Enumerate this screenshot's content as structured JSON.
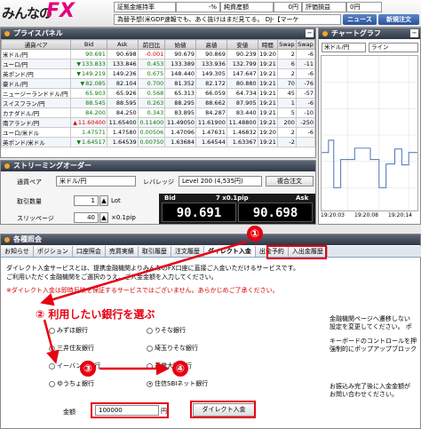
{
  "header": {
    "logo_text": "みんなの",
    "logo_fx": "FX",
    "info": [
      {
        "label": "証拠金維持率",
        "value": "-%"
      },
      {
        "label": "純資産額",
        "value": "0円"
      },
      {
        "label": "評価損益",
        "value": "0円"
      }
    ],
    "ticker": "為替予想(米GDP速報でも、あく抜けはまだ見てる。 DJ-【マーケ",
    "news_btn": "ニュース",
    "new_order_btn": "新規注文"
  },
  "price_panel": {
    "title": "プライスパネル",
    "columns": [
      "通貨ペア",
      "Bid",
      "Ask",
      "前日比",
      "始値",
      "高値",
      "安値",
      "時間",
      "Swap",
      "Swap"
    ],
    "rows": [
      {
        "pair": "米ドル/円",
        "bid": "90.691",
        "ask": "90.698",
        "chg": "-0.001",
        "open": "90.679",
        "high": "90.869",
        "low": "90.239",
        "time": "19:20",
        "s1": "2",
        "s2": "-6",
        "dir": "none"
      },
      {
        "pair": "ユーロ/円",
        "bid": "133.833",
        "ask": "133.846",
        "chg": "0.453",
        "open": "133.389",
        "high": "133.936",
        "low": "132.799",
        "time": "19:21",
        "s1": "6",
        "s2": "-11",
        "dir": "up"
      },
      {
        "pair": "英ポンド/円",
        "bid": "149.219",
        "ask": "149.236",
        "chg": "0.675",
        "open": "148.440",
        "high": "149.305",
        "low": "147.647",
        "time": "19:21",
        "s1": "2",
        "s2": "-6",
        "dir": "up"
      },
      {
        "pair": "豪ドル/円",
        "bid": "82.085",
        "ask": "82.104",
        "chg": "0.700",
        "open": "81.352",
        "high": "82.172",
        "low": "80.880",
        "time": "19:21",
        "s1": "70",
        "s2": "-76",
        "dir": "up"
      },
      {
        "pair": "ニュージーランドドル/円",
        "bid": "65.903",
        "ask": "65.926",
        "chg": "0.568",
        "open": "65.313",
        "high": "66.059",
        "low": "64.734",
        "time": "19:21",
        "s1": "45",
        "s2": "-57",
        "dir": "none"
      },
      {
        "pair": "スイスフラン/円",
        "bid": "88.545",
        "ask": "88.595",
        "chg": "0.263",
        "open": "88.295",
        "high": "88.662",
        "low": "87.905",
        "time": "19:21",
        "s1": "1",
        "s2": "-6",
        "dir": "none"
      },
      {
        "pair": "カナダドル/円",
        "bid": "84.200",
        "ask": "84.250",
        "chg": "0.343",
        "open": "83.895",
        "high": "84.287",
        "low": "83.440",
        "time": "19:21",
        "s1": "5",
        "s2": "-10",
        "dir": "none"
      },
      {
        "pair": "南アランド/円",
        "bid": "11.60400",
        "ask": "11.65400",
        "chg": "0.11400",
        "open": "11.49050",
        "high": "11.61900",
        "low": "11.48800",
        "time": "19:21",
        "s1": "200",
        "s2": "-250",
        "dir": "down"
      },
      {
        "pair": "ユーロ/米ドル",
        "bid": "1.47571",
        "ask": "1.47580",
        "chg": "0.00506",
        "open": "1.47096",
        "high": "1.47631",
        "low": "1.46832",
        "time": "19:20",
        "s1": "2",
        "s2": "-6",
        "dir": "none"
      },
      {
        "pair": "英ポンド/米ドル",
        "bid": "1.64517",
        "ask": "1.64539",
        "chg": "0.00750",
        "open": "1.63684",
        "high": "1.64544",
        "low": "1.63367",
        "time": "19:21",
        "s1": "-2",
        "s2": "",
        "dir": "up"
      }
    ]
  },
  "chart_panel": {
    "title": "チャートグラフ",
    "pair_select": "米ドル/円",
    "type_select": "ライン",
    "x_ticks": [
      "19:20:03",
      "19:20:08",
      "19:20:14"
    ]
  },
  "order_panel": {
    "title": "ストリーミングオーダー",
    "pair_label": "通貨ペア",
    "pair_value": "米ドル/円",
    "leverage_label": "レバレッジ",
    "leverage_value": "Level 200 (4,535円)",
    "complex_btn": "複合注文",
    "lot_label": "取引数量",
    "lot_value": "1",
    "lot_unit": "Lot",
    "slip_label": "スリッページ",
    "slip_value": "40",
    "slip_unit": "×0.1pip",
    "bid_label": "Bid",
    "spread": "7 x0.1pip",
    "ask_label": "Ask",
    "bid_price": "90.691",
    "ask_price": "90.698"
  },
  "inquiry_panel": {
    "title": "各種照会",
    "tabs": [
      "お知らせ",
      "ポジション",
      "口座照会",
      "売買実績",
      "取引履歴",
      "注文履歴",
      "ダイレクト入金",
      "出金予約",
      "入出金履歴"
    ],
    "active_tab": "ダイレクト入金",
    "desc1": "ダイレクト入金サービスとは、提携金融機関よりみんなのFX口座に直接ご入金いただけるサービスです。",
    "desc2": "ご利用いただく金融機関をご選択のうえ、ご入金金額を入力してください。",
    "warn": "※ダイレクト入金は即時反映を保証するサービスではございません。あらかじめご了承ください。",
    "banks": [
      "みずほ銀行",
      "りそな銀行",
      "三井住友銀行",
      "埼玉りそな銀行",
      "イーバンク銀行",
      "近畿大阪銀行",
      "ゆうちょ銀行",
      "住信SBIネット銀行"
    ],
    "amount_label": "金額",
    "amount_value": "100000",
    "amount_unit": "円",
    "submit_btn": "ダイレクト入金",
    "note1": "金融機関ページへ遷移しない",
    "note2": "設定を変更してください。 ポ",
    "note3": "キーボードのコントロールを押",
    "note4": "強制的にポップアップブロック",
    "note5": "お振込み完了後に入金金額が",
    "note6": "お問い合わせください。"
  },
  "annotations": {
    "step1": "①",
    "step2": "② 利用したい銀行を選ぶ",
    "step3": "③",
    "step4": "④",
    "color": "#e60012"
  }
}
